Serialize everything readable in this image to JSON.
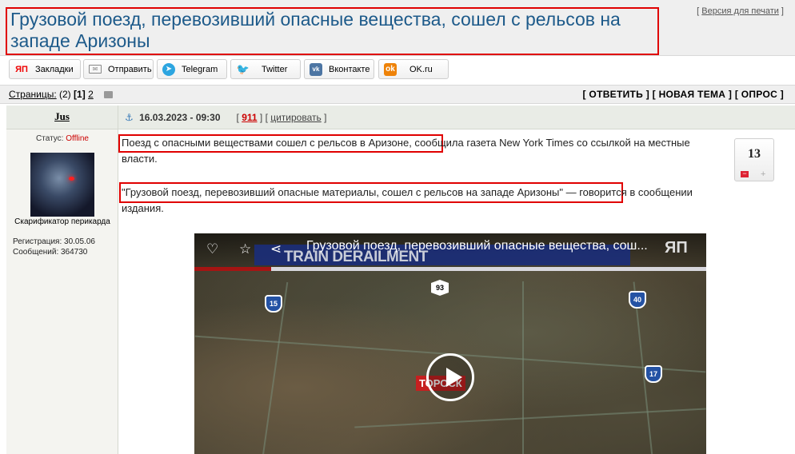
{
  "title": "Грузовой поезд, перевозивший опасные вещества, сошел с рельсов на западе Аризоны",
  "print_link": "Версия для печати",
  "share": {
    "yap": "Закладки",
    "mail": "Отправить",
    "telegram": "Telegram",
    "twitter": "Twitter",
    "vk": "Вконтакте",
    "ok": "OK.ru"
  },
  "pages": {
    "label": "Страницы:",
    "count": "(2)",
    "current": "1",
    "next": "2"
  },
  "actions": "[ ОТВЕТИТЬ ] [ НОВАЯ ТЕМА ] [ ОПРОС ]",
  "post": {
    "author": "Jus",
    "date": "16.03.2023 - 09:30",
    "number": "911",
    "quote_label": "цитировать",
    "status_label": "Статус:",
    "status_value": "Offline",
    "user_title": "Скарификатор перикарда",
    "reg": "Регистрация: 30.05.06",
    "messages": "Сообщений: 364730",
    "para1_hl": "Поезд с опасными веществами сошел с рельсов в Аризоне,",
    "para1_rest": " сообщила газета New York Times со ссылкой на местные власти.",
    "para2_hl": "\"Грузовой поезд, перевозивший опасные материалы, сошел с рельсов на западе Аризоны\"",
    "para2_rest": " — говорится в сообщении издания.",
    "rating": "13"
  },
  "video": {
    "title": "Грузовой поезд, перевозивший опасные вещества, сош...",
    "banner": "TRAIN DERAILMENT",
    "logo": "ЯП",
    "town": "ТОРОСК",
    "route_15": "15",
    "route_40": "40",
    "route_17": "17",
    "route_93": "93"
  },
  "icons": {
    "heart": "heart-icon",
    "star": "star-icon",
    "share": "share-icon",
    "play": "play-icon"
  },
  "colors": {
    "title": "#1d5a8a",
    "highlight_border": "#e00000",
    "post_number": "#cc0000"
  }
}
